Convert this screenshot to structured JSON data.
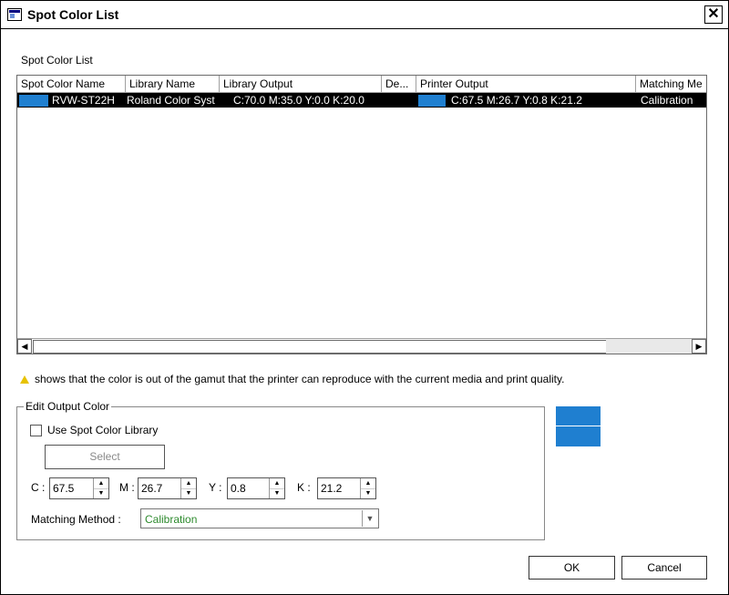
{
  "window": {
    "title": "Spot Color List",
    "close_glyph": "✕"
  },
  "list": {
    "section_label": "Spot Color List",
    "columns": [
      "Spot Color Name",
      "Library Name",
      "Library Output",
      "De...",
      "Printer Output",
      "Matching Me"
    ],
    "rows": [
      {
        "name": "RVW-ST22H",
        "library": "Roland Color Syst",
        "library_output": "C:70.0   M:35.0   Y:0.0     K:20.0",
        "delta": "",
        "printer_output": "C:67.5   M:26.7   Y:0.8     K:21.2",
        "matching": "Calibration",
        "swatch_color": "#1f7fd0"
      }
    ]
  },
  "warning": {
    "text": "shows that the color is out of the gamut that the printer can reproduce with the current media and print quality.",
    "icon": "warning-triangle-icon"
  },
  "edit": {
    "group_label": "Edit Output Color",
    "use_library_label": "Use Spot Color Library",
    "use_library_checked": false,
    "select_label": "Select",
    "c_label": "C :",
    "c_value": "67.5",
    "m_label": "M :",
    "m_value": "26.7",
    "y_label": "Y :",
    "y_value": "0.8",
    "k_label": "K :",
    "k_value": "21.2",
    "matching_label": "Matching Method :",
    "matching_value": "Calibration"
  },
  "preview": {
    "color": "#1f7fd0"
  },
  "buttons": {
    "ok": "OK",
    "cancel": "Cancel"
  }
}
